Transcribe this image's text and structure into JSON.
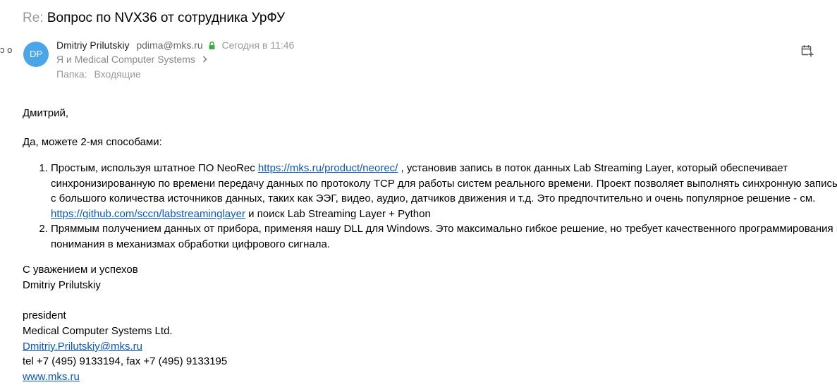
{
  "email": {
    "subject_prefix": "Re:",
    "subject": "Вопрос по NVX36 от сотрудника УрФУ",
    "sender": {
      "initials": "DP",
      "name": "Dmitriy Prilutskiy",
      "email": "pdima@mks.ru",
      "date": "Сегодня в 11:46",
      "avatar_color": "#4aa6e8"
    },
    "recipients": "Я и Medical Computer Systems",
    "folder_label": "Папка:",
    "folder_name": "Входящие",
    "left_edge_fragment": "ɔ o",
    "icons": {
      "lock": "lock-icon",
      "chevron": "chevron-right-icon",
      "calendar": "calendar-add-icon"
    }
  },
  "body": {
    "greeting": "Дмитрий,",
    "intro": "Да, можете 2-мя способами:",
    "item1": {
      "text_a": "Простым, используя штатное ПО NeoRec ",
      "link_a": "https://mks.ru/product/neorec/",
      "text_b": " , установив запись в поток  данных Lab Streaming Layer, который обеспечивает синхронизированную по времени передачу данных по протоколу TCP для работы систем реального времени. Проект позволяет выполнять синхронную запись с большого количества источников данных, таких как ЭЭГ, видео, аудио, датчиков движения и т.д. Это предпочтительно и очень популярное решение - см. ",
      "link_b": "https://github.com/sccn/labstreaminglayer",
      "text_c": " и поиск Lab Streaming Layer + Python"
    },
    "item2": "Пряммым получением данных от прибора, применяя нашу DLL для Windows. Это максимально гибкое решение, но требует качественного программирования и понимания в механизмах обработки цифрового сигнала.",
    "signature": {
      "closing": "С уважением и успехов",
      "name": "Dmitriy Prilutskiy",
      "title": "president",
      "company": "Medical Computer Systems Ltd.",
      "email": "Dmitriy.Prilutskiy@mks.ru",
      "phone": "tel +7 (495) 9133194, fax +7 (495) 9133195",
      "website": "www.mks.ru"
    },
    "link_color": "#0a57c2"
  }
}
